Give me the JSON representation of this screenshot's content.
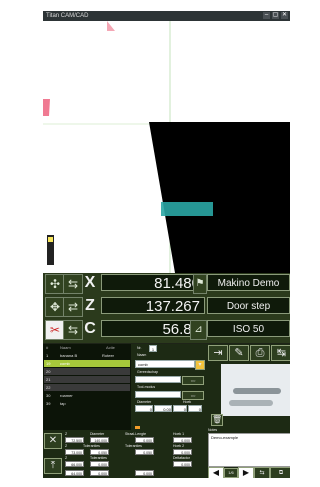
{
  "window": {
    "title": "Titan CAM/CAD",
    "controls": [
      "–",
      "▢",
      "✕"
    ]
  },
  "dro": {
    "axes": [
      {
        "name": "X",
        "value": "81.480",
        "side_label": "Makino Demo"
      },
      {
        "name": "Z",
        "value": "137.267",
        "side_label": "Door step"
      },
      {
        "name": "C",
        "value": "56.88",
        "side_label": "ISO 50"
      }
    ]
  },
  "tools_list": {
    "header": [
      "#",
      "Naam",
      "Actie"
    ],
    "items": [
      {
        "n": "1",
        "name": "banana B",
        "action": "Roteer"
      },
      {
        "n": "19",
        "name": "comb",
        "action": ""
      },
      {
        "n": "20",
        "name": "",
        "action": ""
      },
      {
        "n": "21",
        "name": "",
        "action": ""
      },
      {
        "n": "22",
        "name": "",
        "action": ""
      },
      {
        "n": "30",
        "name": "roamer",
        "action": ""
      },
      {
        "n": "39",
        "name": "tap",
        "action": ""
      }
    ],
    "selected_index": 1
  },
  "tool_form": {
    "num_label": "Nr.",
    "num_value": "1",
    "name_label": "Naam",
    "name_value": "comb",
    "lbl_a": "Gereedschap",
    "lbl_b": "Tool-modus",
    "lbl_c": "Diameter",
    "lbl_d": "Hoek",
    "row_values": [
      "0",
      "0.00",
      "0",
      "0"
    ]
  },
  "params": {
    "labels": [
      "Z",
      "Diameter",
      "Straal-Lengte",
      "Hoek 1",
      "Z",
      "Toleranties",
      "Toleranties",
      "Hoek 2",
      "Z",
      "Toleranties",
      "Deltafactor"
    ],
    "values": [
      "72.500",
      "140.000",
      "0.000",
      "0.000",
      "73.000",
      "0.050",
      "0.050",
      "0.000",
      "66.000",
      "0.000",
      "0.000"
    ],
    "row3": [
      "64.000",
      "0.000",
      "0.000"
    ],
    "notes_label": "Notes",
    "notes_text": "Demo-example",
    "page": "1/6"
  }
}
